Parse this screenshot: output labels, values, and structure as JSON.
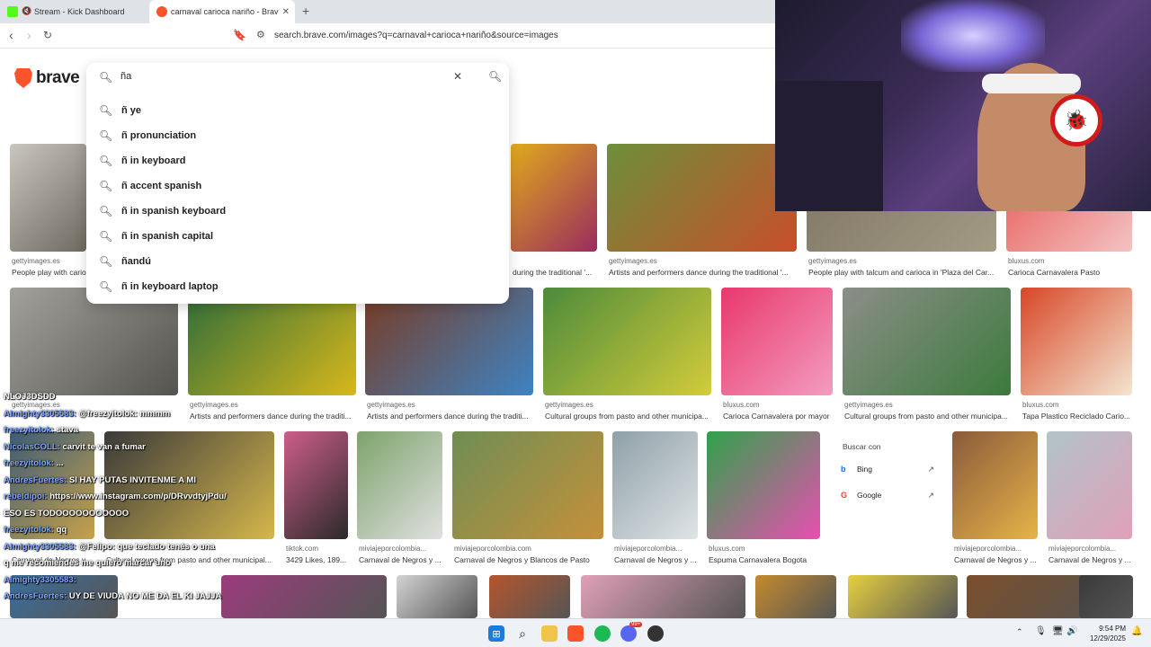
{
  "tabs": [
    {
      "label": "Stream - Kick Dashboard",
      "active": false
    },
    {
      "label": "carnaval carioca nariño - Brave S",
      "active": true
    }
  ],
  "address": {
    "url": "search.brave.com/images?q=carnaval+carioca+nariño&source=images"
  },
  "brand": {
    "name": "brave"
  },
  "search": {
    "value": "ña",
    "suggestions": [
      "ñ ye",
      "ñ pronunciation",
      "ñ in keyboard",
      "ñ accent spanish",
      "ñ in spanish keyboard",
      "ñ in spanish capital",
      "ñandú",
      "ñ in keyboard laptop"
    ]
  },
  "results": {
    "row1": [
      {
        "source": "gettyimages.es",
        "caption": "People play with carioc",
        "colors": [
          "#c9c6be",
          "#6f6a60"
        ]
      },
      {
        "source": "",
        "caption": "during the traditional '...",
        "colors": [
          "#e0aa1c",
          "#9b2b5e"
        ]
      },
      {
        "source": "gettyimages.es",
        "caption": "Artists and performers dance during the traditional '...",
        "colors": [
          "#6d8f3a",
          "#c94e2b"
        ]
      },
      {
        "source": "gettyimages.es",
        "caption": "People play with talcum and carioca in 'Plaza del Car...",
        "colors": [
          "#7c7261",
          "#a49b85"
        ]
      },
      {
        "source": "bluxus.com",
        "caption": "Carioca Carnavalera Pasto",
        "colors": [
          "#e7524e",
          "#f3c3c3"
        ]
      }
    ],
    "row2": [
      {
        "source": "gettyimages.es",
        "caption": "",
        "colors": [
          "#a3a19b",
          "#55534e"
        ]
      },
      {
        "source": "gettyimages.es",
        "caption": "Artists and performers dance during the traditi...",
        "colors": [
          "#2e6d3a",
          "#d8b81a"
        ]
      },
      {
        "source": "gettyimages.es",
        "caption": "Artists and performers dance during the traditi...",
        "colors": [
          "#7a3b22",
          "#3d83c4"
        ]
      },
      {
        "source": "gettyimages.es",
        "caption": "Cultural groups from pasto and other municipa...",
        "colors": [
          "#4c8b3b",
          "#d3cc3a"
        ]
      },
      {
        "source": "bluxus.com",
        "caption": "Carioca Carnavalera por mayor",
        "colors": [
          "#e8386b",
          "#f49cc0"
        ]
      },
      {
        "source": "gettyimages.es",
        "caption": "Cultural groups from pasto and other municipa...",
        "colors": [
          "#8c8e89",
          "#3c7a3c"
        ]
      },
      {
        "source": "bluxus.com",
        "caption": "Tapa Plastico Reciclado Cario...",
        "colors": [
          "#d84726",
          "#f3e5d0"
        ]
      }
    ],
    "row3": [
      {
        "source": "",
        "caption": "Carnaval de Negros y ...",
        "colors": [
          "#3c5b77",
          "#c7a24a"
        ]
      },
      {
        "source": "",
        "caption": "Cultural groups from pasto and other municipal...",
        "colors": [
          "#3a3a3a",
          "#d6b74b"
        ]
      },
      {
        "source": "tiktok.com",
        "caption": "3429 Likes, 189...",
        "colors": [
          "#ce5e8a",
          "#2a2a2a"
        ]
      },
      {
        "source": "miviajeporcolombia...",
        "caption": "Carnaval de Negros y ...",
        "colors": [
          "#7da36b",
          "#e0e0e0"
        ]
      },
      {
        "source": "miviajeporcolombia.com",
        "caption": "Carnaval de Negros y Blancos de Pasto",
        "colors": [
          "#6f8e54",
          "#c4903a"
        ]
      },
      {
        "source": "miviajeporcolombia...",
        "caption": "Carnaval de Negros y ...",
        "colors": [
          "#8fa0a8",
          "#dfe4e6"
        ]
      },
      {
        "source": "bluxus.com",
        "caption": "Espuma Carnavalera Bogota",
        "colors": [
          "#2fa24b",
          "#e84fb1"
        ]
      },
      {
        "source": "miviajeporcolombia...",
        "caption": "Carnaval de Negros y ...",
        "colors": [
          "#8a5a3b",
          "#e6b448"
        ]
      },
      {
        "source": "miviajeporcolombia...",
        "caption": "Carnaval de Negros y ...",
        "colors": [
          "#b2c3c8",
          "#e0a0b8"
        ]
      }
    ],
    "row4_colors": [
      "#3c6e9a",
      "#9b3c7d",
      "#d3d3d3",
      "#b6552d",
      "#e0a0b8",
      "#c48b2c",
      "#e6cf3f",
      "#7a4e2a",
      "#3a3a3a"
    ]
  },
  "search_with": {
    "heading": "Buscar con",
    "engines": [
      "Bing",
      "Google"
    ]
  },
  "chat": [
    {
      "name": "",
      "text": "NLOJ3DSDD"
    },
    {
      "name": "Almighty3305583:",
      "text": "@freezyitolok: mmmm"
    },
    {
      "name": "freezyitolok:",
      "text": "stava"
    },
    {
      "name": "NicolasCOLL:",
      "text": "carvit te van a fumar"
    },
    {
      "name": "freezyitolok:",
      "text": "..."
    },
    {
      "name": "AndresFuertes:",
      "text": "SI HAY PUTAS INVITENME A MI"
    },
    {
      "name": "rebeldipoi:",
      "text": "https://www.instagram.com/p/DRvvdtyjPdu/"
    },
    {
      "name": "",
      "text": "ESO ES TODOOOOOOOOOOO"
    },
    {
      "name": "freezyitolok:",
      "text": "qq"
    },
    {
      "name": "Almighty3305583:",
      "text": "@Felipo: que teclado tenés o una"
    },
    {
      "name": "",
      "text": "q me recomiendes me quiero marcar uno"
    },
    {
      "name": "Almighty3305583:",
      "text": ""
    },
    {
      "name": "AndresFuertes:",
      "text": "UY DE VIUDA NO ME DA EL KI JAJJA"
    }
  ],
  "taskbar": {
    "time": "9:54 PM",
    "date": "12/29/2025",
    "badge": "99+"
  }
}
